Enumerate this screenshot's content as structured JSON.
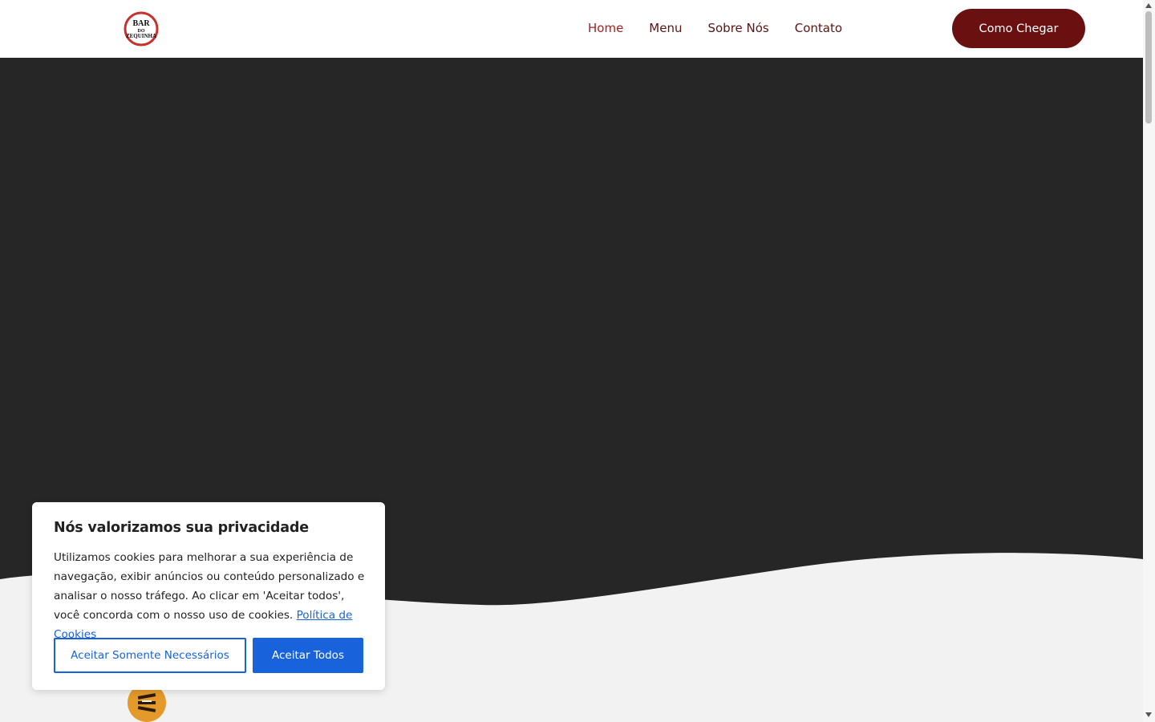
{
  "header": {
    "logo_text": [
      "BAR",
      "DO",
      "ZEQUINHA"
    ],
    "nav": [
      {
        "label": "Home",
        "active": true
      },
      {
        "label": "Menu",
        "active": false
      },
      {
        "label": "Sobre Nós",
        "active": false
      },
      {
        "label": "Contato",
        "active": false
      }
    ],
    "cta_label": "Como Chegar"
  },
  "colors": {
    "brand": "#6b1010",
    "nav_active": "#a5201f",
    "hero_bg": "#262626",
    "cookie_accent": "#1863dc",
    "badge": "#e49a2b"
  },
  "cookie": {
    "title": "Nós valorizamos sua privacidade",
    "body": "Utilizamos cookies para melhorar a sua experiência de navegação, exibir anúncios ou conteúdo personalizado e analisar o nosso tráfego. Ao clicar em 'Aceitar todos', você concorda com o nosso uso de cookies.",
    "policy_link": "Política de Cookies",
    "btn_necessary": "Aceitar Somente Necessários",
    "btn_all": "Aceitar Todos"
  },
  "icons": {
    "badge": "beer-glasses-icon"
  }
}
